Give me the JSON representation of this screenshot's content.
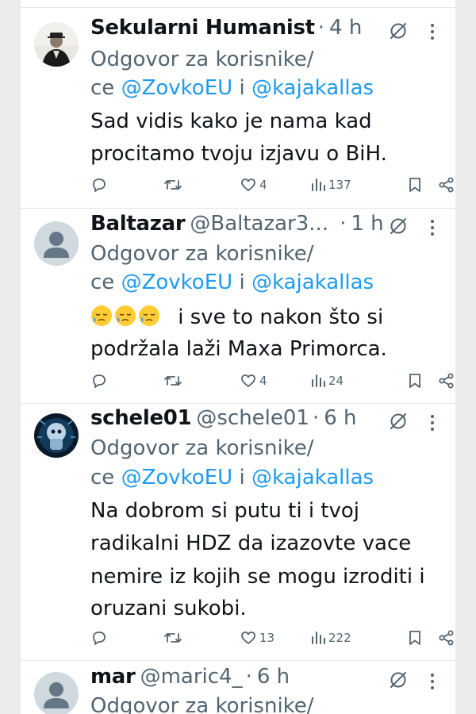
{
  "tweets": [
    {
      "name": "Sekularni Humanist",
      "handle": "",
      "time": "4 h",
      "reply_prefix": "Odgovor za korisnike/",
      "reply_ce": "ce",
      "mention1": "@ZovkoEU",
      "reply_and": "i",
      "mention2": "@kajakallas",
      "text_lines": [
        "Sad vidis kako je nama kad",
        "procitamo tvoju izjavu o BiH."
      ],
      "likes": "4",
      "views": "137",
      "avatar": "photo-man-suit"
    },
    {
      "name": "Baltazar",
      "handle": "@Baltazar3...",
      "time": "1 h",
      "reply_prefix": "Odgovor za korisnike/",
      "reply_ce": "ce",
      "mention1": "@ZovkoEU",
      "reply_and": "i",
      "mention2": "@kajakallas",
      "text_lines": [
        "i sve to nakon što si",
        "podržala laži Maxa Primorca."
      ],
      "emojis": [
        "sleepy-face-emoji",
        "sleepy-face-emoji",
        "sleepy-face-emoji"
      ],
      "likes": "4",
      "views": "24",
      "avatar": "default-avatar"
    },
    {
      "name": "schele01",
      "handle": "@schele01",
      "time": "6 h",
      "reply_prefix": "Odgovor za korisnike/",
      "reply_ce": "ce",
      "mention1": "@ZovkoEU",
      "reply_and": "i",
      "mention2": "@kajakallas",
      "text_lines": [
        "Na dobrom si putu ti i tvoj",
        "radikalni HDZ da izazovte vace",
        "nemire iz kojih se mogu izroditi i",
        "oruzani sukobi."
      ],
      "likes": "13",
      "views": "222",
      "avatar": "photo-blue-robot"
    },
    {
      "name": "mar",
      "handle": "@maric4_",
      "time": "6 h",
      "reply_prefix": "Odgovor za korisnike/",
      "avatar": "default-avatar"
    }
  ],
  "dot_separator": "·",
  "colors": {
    "mention": "#1d9bf0",
    "secondary": "#536471",
    "text": "#0f1419",
    "divider": "#e3e3e3"
  }
}
